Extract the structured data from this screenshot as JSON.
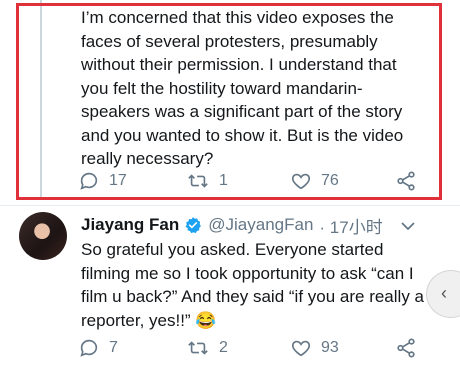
{
  "parent_tweet": {
    "text": "I’m concerned that this video exposes the faces of several protesters, presumably without their permission. I understand that you felt the hostility toward mandarin-speakers was a significant part of the story and you wanted to show it. But is the video really necessary?",
    "replies": "17",
    "retweets": "1",
    "likes": "76"
  },
  "reply_tweet": {
    "name": "Jiayang Fan",
    "handle": "@JiayangFan",
    "time": "· 17小时",
    "text": "So grateful you asked. Everyone started filming me so I took opportunity to ask “can I film u back?” And they said “if you are really a reporter, yes!!” 😂",
    "replies": "7",
    "retweets": "2",
    "likes": "93"
  },
  "colors": {
    "highlight": "#e0313b",
    "verified": "#1da1f2",
    "action_gray": "#657786"
  }
}
